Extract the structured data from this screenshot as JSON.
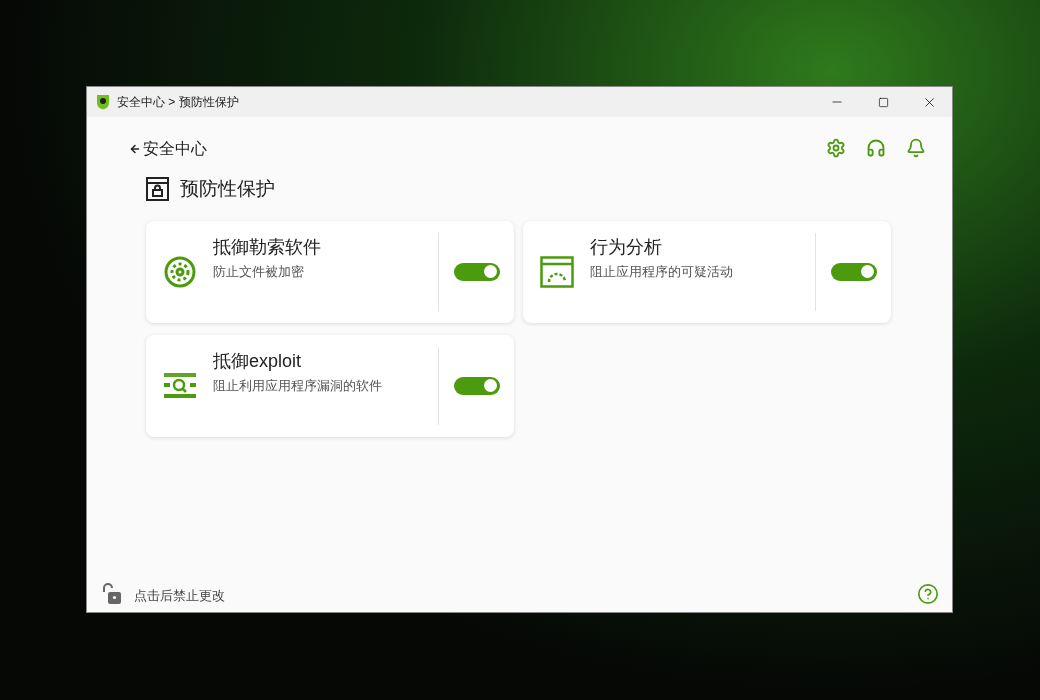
{
  "window": {
    "title": "安全中心 > 预防性保护"
  },
  "back_link": "安全中心",
  "page_title": "预防性保护",
  "cards": [
    {
      "kind": "ransomware",
      "title": "抵御勒索软件",
      "description": "防止文件被加密",
      "on": true
    },
    {
      "kind": "behavior",
      "title": "行为分析",
      "description": "阻止应用程序的可疑活动",
      "on": true
    },
    {
      "kind": "exploit",
      "title": "抵御exploit",
      "description": "阻止利用应用程序漏洞的软件",
      "on": true
    }
  ],
  "footer": {
    "lock_label": "点击后禁止更改"
  }
}
